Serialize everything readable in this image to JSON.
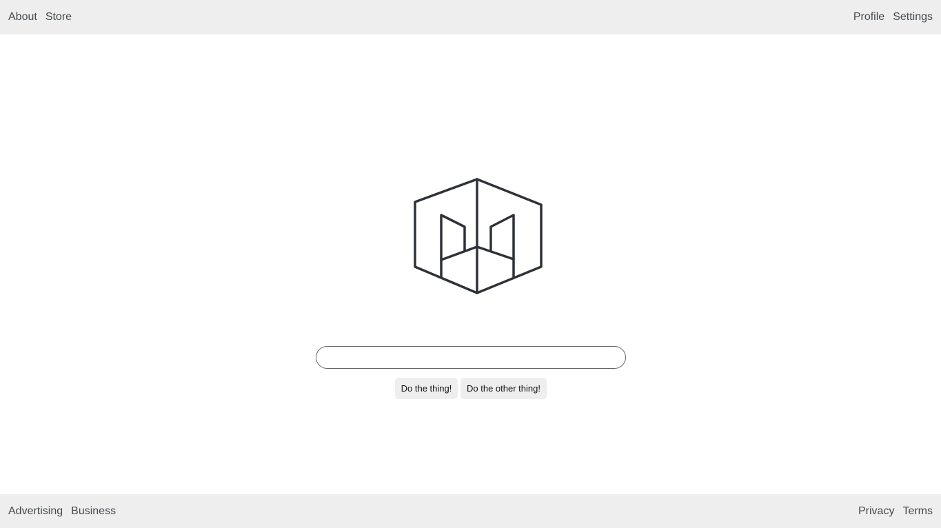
{
  "header": {
    "left_links": [
      {
        "label": "About"
      },
      {
        "label": "Store"
      }
    ],
    "right_links": [
      {
        "label": "Profile"
      },
      {
        "label": "Settings"
      }
    ]
  },
  "logo": {
    "icon": "cube-logo-icon",
    "color": "#2e3238"
  },
  "search": {
    "value": "",
    "placeholder": ""
  },
  "actions": {
    "primary_label": "Do the thing!",
    "secondary_label": "Do the other thing!"
  },
  "footer": {
    "left_links": [
      {
        "label": "Advertising"
      },
      {
        "label": "Business"
      }
    ],
    "right_links": [
      {
        "label": "Privacy"
      },
      {
        "label": "Terms"
      }
    ]
  },
  "colors": {
    "bar_background": "#eeeeee",
    "link_text": "#444a4f",
    "page_background": "#ffffff"
  }
}
